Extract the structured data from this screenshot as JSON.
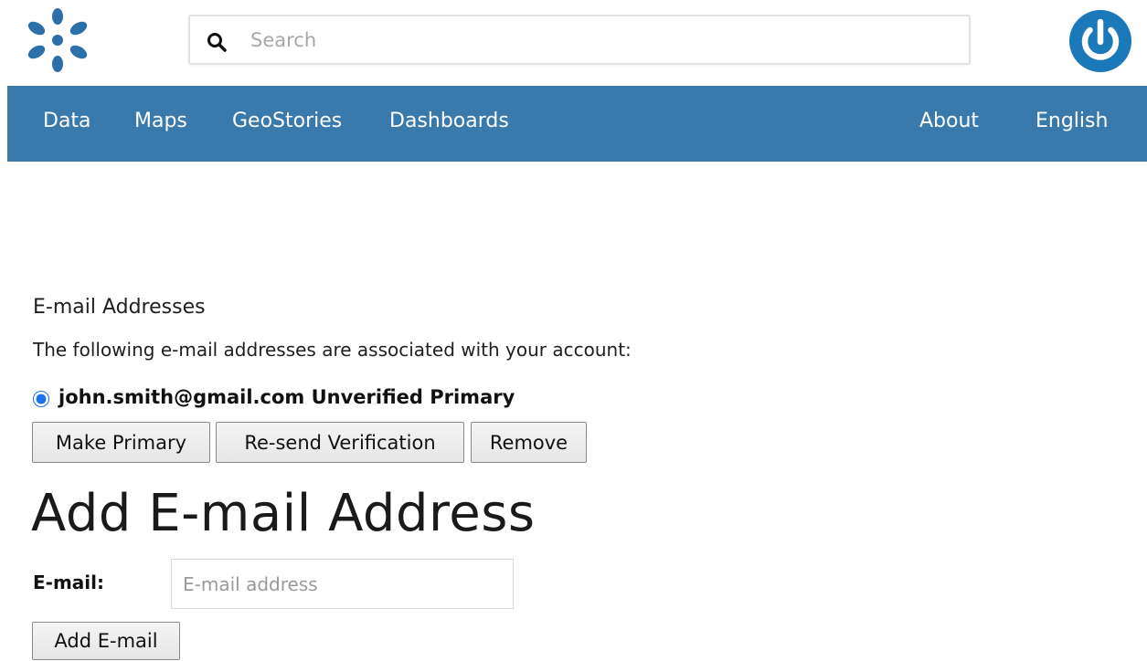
{
  "header": {
    "logo_icon": "geonode-logo-icon",
    "search_placeholder": "Search",
    "search_icon": "search-icon",
    "user_icon": "power-icon",
    "brand_color": "#1b78b9"
  },
  "nav": {
    "background": "#3a79ab",
    "left_items": [
      {
        "label": "Data"
      },
      {
        "label": "Maps"
      },
      {
        "label": "GeoStories"
      },
      {
        "label": "Dashboards"
      }
    ],
    "right_items": [
      {
        "label": "About"
      },
      {
        "label": "English"
      }
    ]
  },
  "emails": {
    "title": "E-mail Addresses",
    "description": "The following e-mail addresses are associated with your account:",
    "entries": [
      {
        "label": "john.smith@gmail.com Unverified Primary",
        "selected": true
      }
    ],
    "buttons": {
      "make_primary": "Make Primary",
      "resend": "Re-send Verification",
      "remove": "Remove"
    }
  },
  "add_email": {
    "title": "Add E-mail Address",
    "field_label": "E-mail:",
    "placeholder": "E-mail address",
    "submit": "Add E-mail"
  }
}
